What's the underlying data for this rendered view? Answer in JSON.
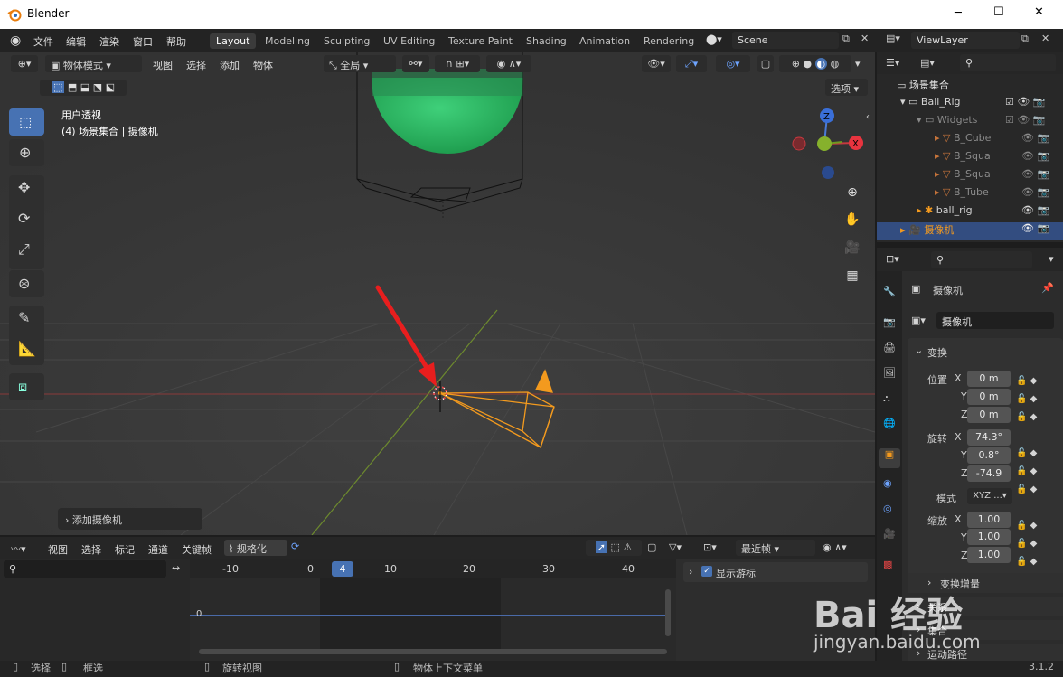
{
  "window": {
    "title": "Blender",
    "min": "─",
    "max": "☐",
    "close": "✕"
  },
  "menu": [
    "文件",
    "编辑",
    "渲染",
    "窗口",
    "帮助"
  ],
  "workspaces": [
    "Layout",
    "Modeling",
    "Sculpting",
    "UV Editing",
    "Texture Paint",
    "Shading",
    "Animation",
    "Rendering"
  ],
  "scene": "Scene",
  "view_layer": "ViewLayer",
  "viewport_header": {
    "mode": "物体模式",
    "menus": [
      "视图",
      "选择",
      "添加",
      "物体"
    ],
    "orientation": "全局",
    "options": "选项"
  },
  "viewport": {
    "view_name": "用户透视",
    "collection_info": "(4) 场景集合 | 摄像机",
    "operator_panel": "添加摄像机",
    "gizmo": {
      "z": "Z",
      "x": "X"
    }
  },
  "outliner": {
    "root": "场景集合",
    "rows": [
      {
        "label": "Ball_Rig"
      },
      {
        "label": "Widgets"
      },
      {
        "label": "B_Cube"
      },
      {
        "label": "B_Squa"
      },
      {
        "label": "B_Squa"
      },
      {
        "label": "B_Tube"
      },
      {
        "label": "ball_rig"
      },
      {
        "label": "摄像机"
      }
    ]
  },
  "properties": {
    "object_name": "摄像机",
    "data_name": "摄像机",
    "section": "变换",
    "location": {
      "label": "位置",
      "x": "0 m",
      "y": "0 m",
      "z": "0 m"
    },
    "rotation": {
      "label": "旋转",
      "x": "74.3°",
      "y": "0.8°",
      "z": "-74.9"
    },
    "mode": {
      "label": "模式",
      "value": "XYZ ..."
    },
    "scale": {
      "label": "缩放",
      "x": "1.00",
      "y": "1.00",
      "z": "1.00"
    },
    "axes": {
      "x": "X",
      "y": "Y",
      "z": "Z"
    },
    "subsections": [
      "变换增量",
      "关系",
      "集合",
      "运动路径"
    ]
  },
  "timeline": {
    "menus": [
      "视图",
      "选择",
      "标记",
      "通道",
      "关键帧"
    ],
    "normalize": "规格化",
    "snap": "最近帧",
    "ticks": [
      "-10",
      "0",
      "4",
      "10",
      "20",
      "30",
      "40"
    ],
    "current_frame": "4",
    "channel_value": "0",
    "show_cursor": "显示游标"
  },
  "status": {
    "select": "选择",
    "box": "框选",
    "rotate": "旋转视图",
    "context": "物体上下文菜单",
    "version": "3.1.2"
  },
  "watermark": {
    "brand": "Bai 经验",
    "url": "jingyan.baidu.com"
  },
  "colors": {
    "accent": "#4772b3",
    "selected": "#f39a1e",
    "green": "#2fbf66",
    "red": "#e8343f"
  }
}
